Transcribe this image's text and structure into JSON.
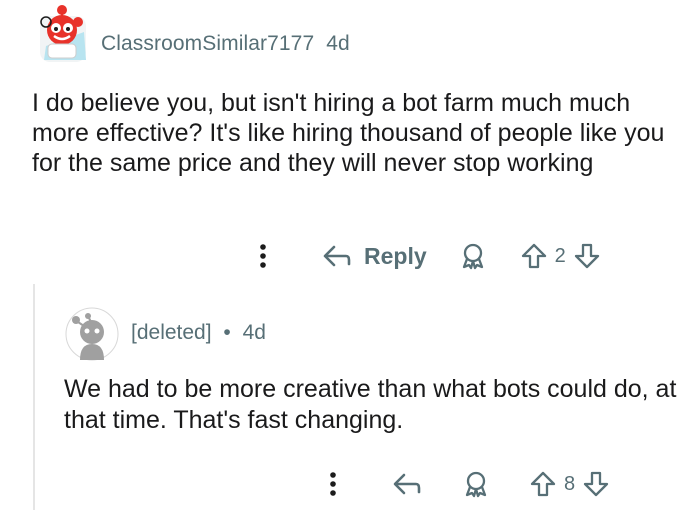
{
  "comment": {
    "username": "ClassroomSimilar7177",
    "age": "4d",
    "body": "I do believe you, but isn't hiring a bot farm much much more effective? It's like hiring thousand of people like you for the same price and they will never stop working",
    "actions": {
      "reply_label": "Reply",
      "vote_count": "2"
    }
  },
  "reply": {
    "username": "[deleted]",
    "separator": "•",
    "age": "4d",
    "body": "We had to be more creative than what bots could do, at that time. That's fast changing.",
    "actions": {
      "vote_count": "8"
    }
  },
  "colors": {
    "meta_text": "#576f76",
    "body_text": "#1a1a1b",
    "thread_line": "#e5e5e5",
    "avatar_red": "#e8322a"
  },
  "icons": [
    "avatar-snoo-icon",
    "more-options-icon",
    "reply-arrow-icon",
    "award-icon",
    "upvote-icon",
    "downvote-icon",
    "deleted-avatar-icon"
  ]
}
